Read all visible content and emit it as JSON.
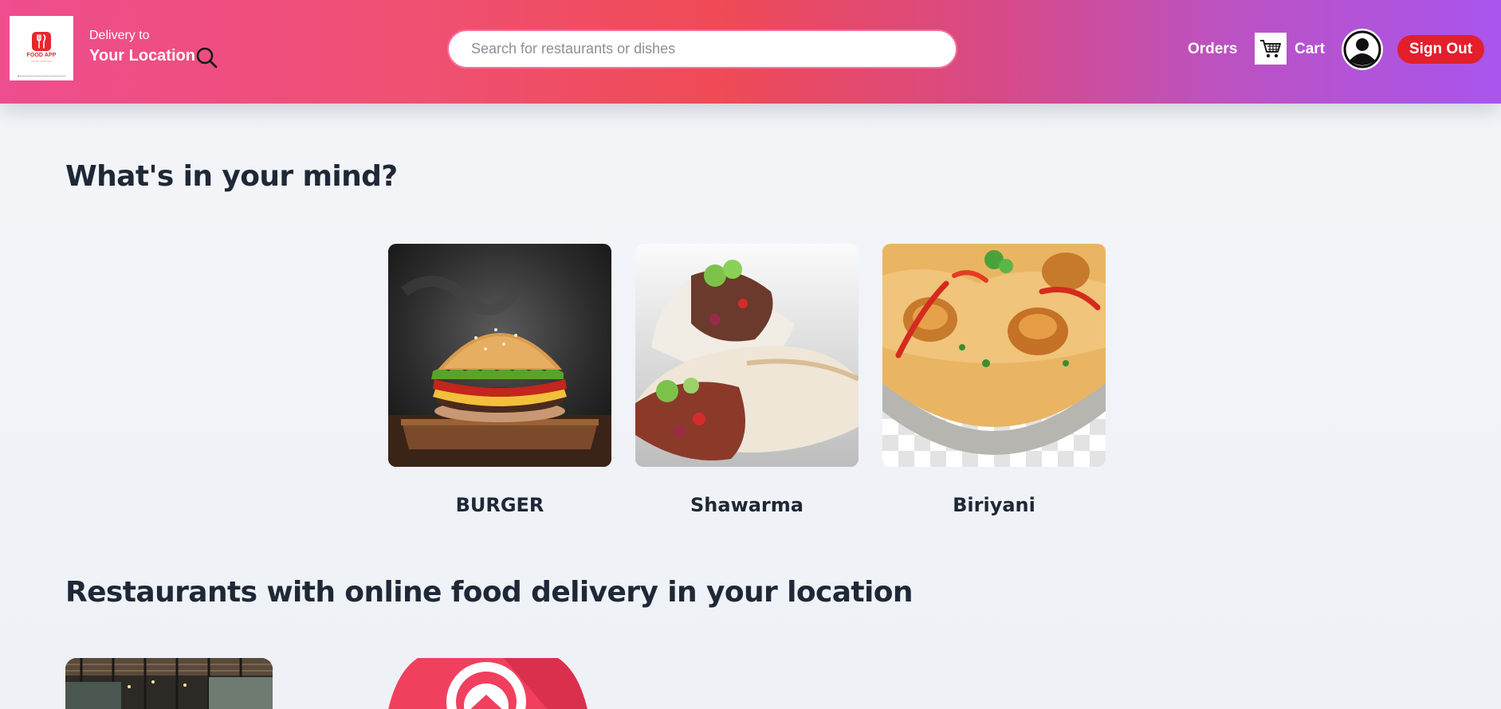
{
  "header": {
    "logo": {
      "title": "FOOD APP",
      "tagline": "TASTE YOUR WAY"
    },
    "delivery": {
      "label": "Delivery to",
      "location": "Your Location"
    },
    "search": {
      "placeholder": "Search for restaurants or dishes",
      "value": ""
    },
    "nav": {
      "orders_label": "Orders",
      "cart_label": "Cart",
      "signout_label": "Sign Out"
    }
  },
  "main": {
    "categories_title": "What's in your mind?",
    "categories": [
      {
        "label": "BURGER",
        "icon": "burger-image"
      },
      {
        "label": "Shawarma",
        "icon": "shawarma-image"
      },
      {
        "label": "Biriyani",
        "icon": "biriyani-image"
      }
    ],
    "restaurants_title": "Restaurants with online food delivery in your location",
    "restaurants": [
      {
        "image": "restaurant-interior-image"
      },
      {
        "image": "home-logo-image"
      }
    ]
  },
  "colors": {
    "header_gradient": [
      "#ee4d8e",
      "#ef4a55",
      "#a955ee"
    ],
    "signout": "#e21f2b",
    "logo_red": "#e8262c",
    "heading": "#1e2836"
  }
}
